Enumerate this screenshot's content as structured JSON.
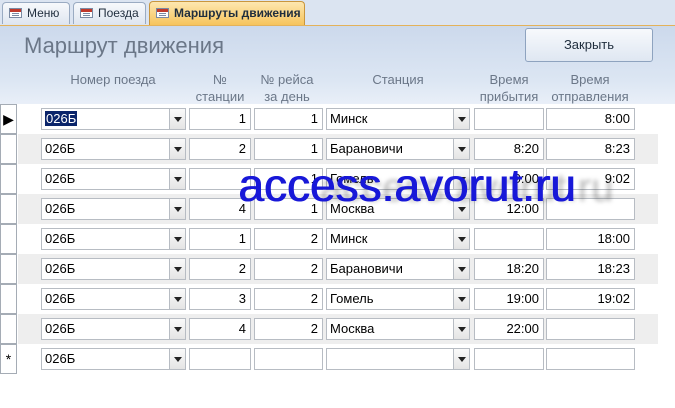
{
  "tabs": [
    {
      "label": "Меню",
      "active": false
    },
    {
      "label": "Поезда",
      "active": false
    },
    {
      "label": "Маршруты движения",
      "active": true
    }
  ],
  "form": {
    "title": "Маршрут движения",
    "close_label": "Закрыть"
  },
  "columns": {
    "train": "Номер поезда",
    "station_no": "№ станции",
    "trip_no": "№ рейса за день",
    "station": "Станция",
    "arrival": "Время прибытия",
    "departure": "Время отправления"
  },
  "records": [
    {
      "train": "026Б",
      "station_no": "1",
      "trip_no": "1",
      "station": "Минск",
      "arrival": "",
      "departure": "8:00"
    },
    {
      "train": "026Б",
      "station_no": "2",
      "trip_no": "1",
      "station": "Барановичи",
      "arrival": "8:20",
      "departure": "8:23"
    },
    {
      "train": "026Б",
      "station_no": "",
      "trip_no": "1",
      "station": "Гомель",
      "arrival": "9:00",
      "departure": "9:02"
    },
    {
      "train": "026Б",
      "station_no": "4",
      "trip_no": "1",
      "station": "Москва",
      "arrival": "12:00",
      "departure": ""
    },
    {
      "train": "026Б",
      "station_no": "1",
      "trip_no": "2",
      "station": "Минск",
      "arrival": "",
      "departure": "18:00"
    },
    {
      "train": "026Б",
      "station_no": "2",
      "trip_no": "2",
      "station": "Барановичи",
      "arrival": "18:20",
      "departure": "18:23"
    },
    {
      "train": "026Б",
      "station_no": "3",
      "trip_no": "2",
      "station": "Гомель",
      "arrival": "19:00",
      "departure": "19:02"
    },
    {
      "train": "026Б",
      "station_no": "4",
      "trip_no": "2",
      "station": "Москва",
      "arrival": "22:00",
      "departure": ""
    },
    {
      "train": "026Б",
      "station_no": "",
      "trip_no": "",
      "station": "",
      "arrival": "",
      "departure": ""
    }
  ],
  "selectors": [
    "▶",
    "",
    "",
    "",
    "",
    "",
    "",
    "",
    "*"
  ],
  "watermark": "access.avorut.ru"
}
